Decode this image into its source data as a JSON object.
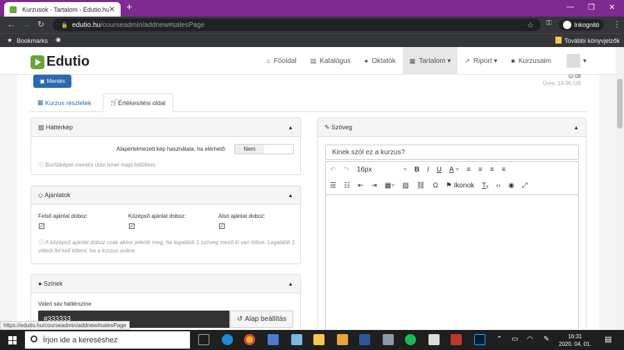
{
  "browser": {
    "tab_title": "Kurzusok - Tartalom - Edutio.hu",
    "new_tab": "+",
    "url_domain": "edutio.hu",
    "url_path": "/courseadmin/addnew#salesPage",
    "incognito_label": "Inkognitó",
    "bookmarks_label": "Bookmarks",
    "other_bookmarks": "További könyvjelzők"
  },
  "navbar": {
    "logo": "Edutio",
    "items": [
      {
        "icon": "home-icon",
        "label": "Főoldal"
      },
      {
        "icon": "list-icon",
        "label": "Katalógus"
      },
      {
        "icon": "user-icon",
        "label": "Oktatók"
      },
      {
        "icon": "content-icon",
        "label": "Tartalom ▾"
      },
      {
        "icon": "chart-icon",
        "label": "Riport ▾"
      },
      {
        "icon": "bookmark-icon",
        "label": "Kurzusaim"
      }
    ]
  },
  "toolbar": {
    "save_label": "Mentés",
    "disk_used": "08",
    "disk_free": "Üres: 19.96 GB"
  },
  "tabs": {
    "course_details": "Kurzus részletek",
    "sales_page": "Értékesítési oldal"
  },
  "background_panel": {
    "title": "Háttérkép",
    "default_label": "Alapértelmezett kép használata, ha elérhető:",
    "toggle_value": "Nem",
    "info": "Borítóképet mentés után lehet majd feltölteni."
  },
  "offers_panel": {
    "title": "Ajánlatok",
    "upper": "Felső ajánlat doboz:",
    "middle": "Középső ajánlat doboz:",
    "lower": "Alsó ajánlat doboz:",
    "info": "A középső ajánlat doboz csak akkor jelenik meg, ha legalább 1 szöveg mező ki van töltve. Legalább 1 videót fel kell tölteni, ha a kurzus online."
  },
  "colors_panel": {
    "title": "Színek",
    "video_bg_label": "Videó sáv háttérszíne",
    "video_bg_value": "#333333",
    "reset_label": "Alap beállítás"
  },
  "text_panel": {
    "title": "Szöveg",
    "subject_value": "Kinek szól ez a kurzus?",
    "font_size": "16px",
    "icons_label": "Ikonok"
  },
  "status_url": "https://edutio.hu/courseadmin/addnew#salesPage",
  "taskbar": {
    "search_placeholder": "Írjon ide a kereséshez",
    "time": "16:31",
    "date": "2020. 04. 01."
  }
}
